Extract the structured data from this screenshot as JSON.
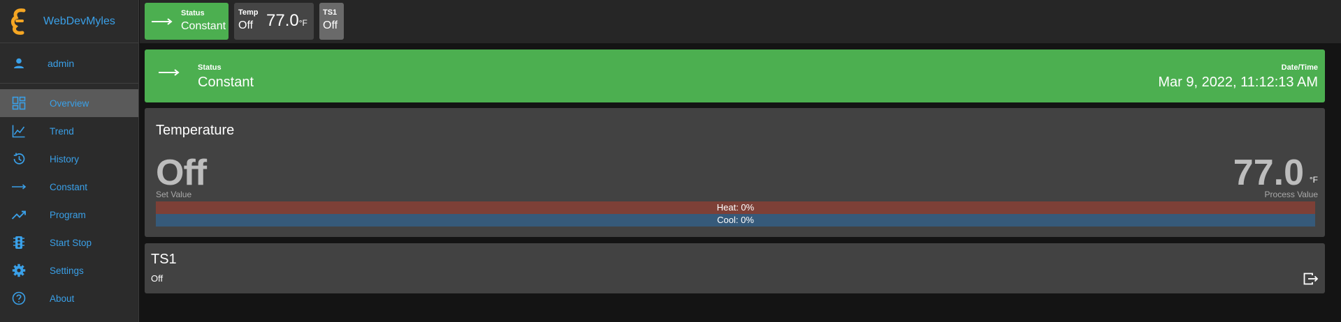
{
  "app": {
    "name": "WebDevMyles"
  },
  "user": {
    "name": "admin"
  },
  "nav": {
    "items": [
      {
        "label": "Overview"
      },
      {
        "label": "Trend"
      },
      {
        "label": "History"
      },
      {
        "label": "Constant"
      },
      {
        "label": "Program"
      },
      {
        "label": "Start Stop"
      },
      {
        "label": "Settings"
      },
      {
        "label": "About"
      }
    ]
  },
  "topbar": {
    "status_label": "Status",
    "status_value": "Constant",
    "temp_label": "Temp",
    "temp_state": "Off",
    "temp_value": "77.0",
    "temp_unit": "°F",
    "ts_label": "TS1",
    "ts_state": "Off"
  },
  "banner": {
    "status_label": "Status",
    "status_value": "Constant",
    "datetime_label": "Date/Time",
    "datetime_value": "Mar 9, 2022, 11:12:13 AM"
  },
  "temperature": {
    "title": "Temperature",
    "set_value": "Off",
    "set_value_label": "Set Value",
    "process_value": "77.0",
    "process_unit": "°F",
    "process_value_label": "Process Value",
    "heat_label": "Heat: 0%",
    "heat_percent": 0,
    "cool_label": "Cool: 0%",
    "cool_percent": 0
  },
  "ts1": {
    "title": "TS1",
    "state": "Off"
  },
  "colors": {
    "accent_blue": "#3aa0e8",
    "status_green": "#4caf50",
    "heat_red": "#7d4037",
    "cool_blue": "#365a7a",
    "logo_orange": "#f5a623"
  }
}
